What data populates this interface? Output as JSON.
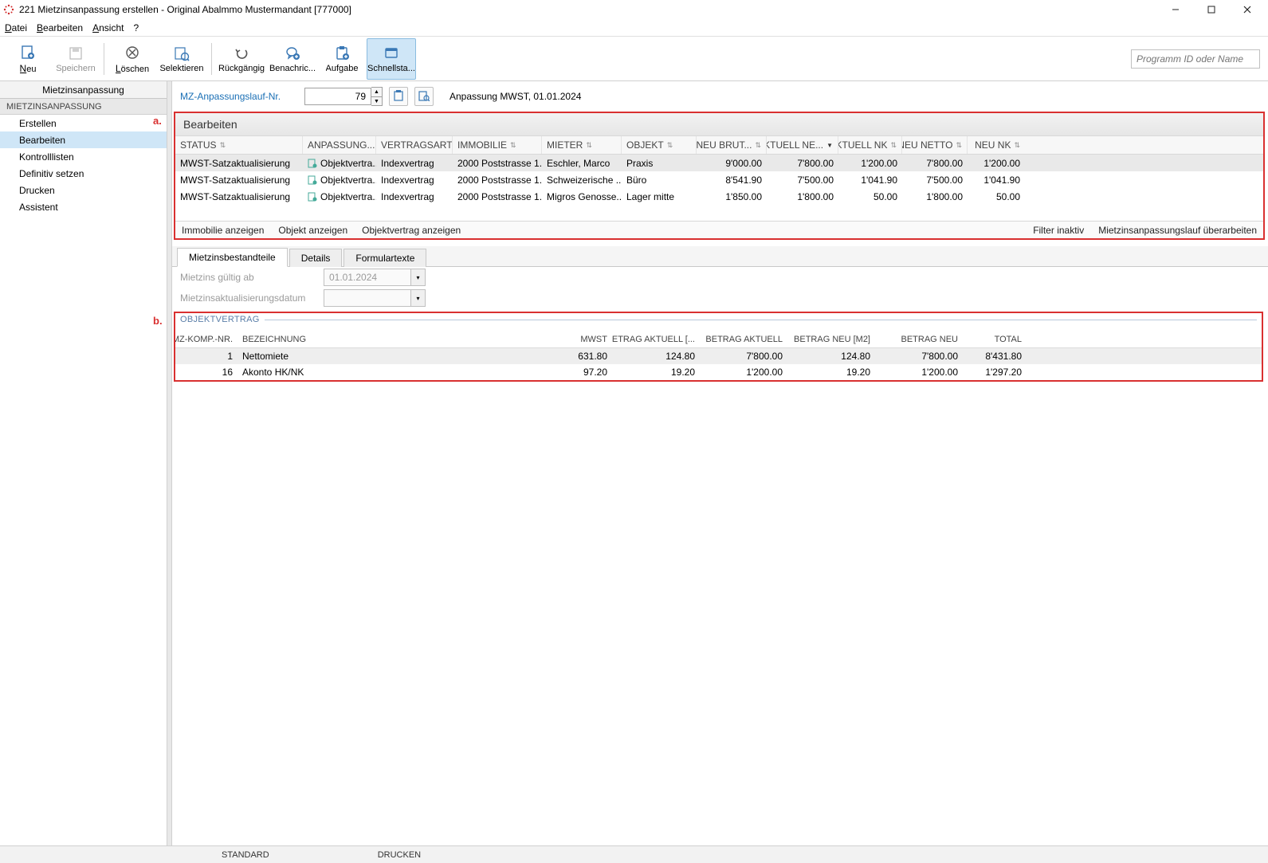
{
  "window": {
    "title": "221 Mietzinsanpassung erstellen - Original Abalmmo Mustermandant [777000]"
  },
  "menu": {
    "datei": "Datei",
    "bearbeiten": "Bearbeiten",
    "ansicht": "Ansicht",
    "help": "?"
  },
  "toolbar": {
    "neu": "Neu",
    "speichern": "Speichern",
    "loeschen": "Löschen",
    "selektieren": "Selektieren",
    "rueckgaengig": "Rückgängig",
    "benachrichtigen": "Benachric...",
    "aufgabe": "Aufgabe",
    "schnellstart": "Schnellsta...",
    "search_placeholder": "Programm ID oder Name"
  },
  "sidebar": {
    "title": "Mietzinsanpassung",
    "group": "MIETZINSANPASSUNG",
    "items": [
      "Erstellen",
      "Bearbeiten",
      "Kontrolllisten",
      "Definitiv setzen",
      "Drucken",
      "Assistent"
    ],
    "selected_index": 1
  },
  "controlrow": {
    "link_label": "MZ-Anpassungslauf-Nr.",
    "value": "79",
    "context": "Anpassung MWST, 01.01.2024"
  },
  "annotations": {
    "a": "a.",
    "b": "b."
  },
  "panelA": {
    "title": "Bearbeiten",
    "columns": [
      "STATUS",
      "ANPASSUNG...",
      "VERTRAGSART",
      "IMMOBILIE",
      "MIETER",
      "OBJEKT",
      "NEU BRUT...",
      "AKTUELL NE...",
      "AKTUELL NK",
      "NEU NETTO",
      "NEU NK"
    ],
    "sorted_desc_col_index": 7,
    "rows": [
      {
        "status": "MWST-Satzaktualisierung",
        "anpassung": "Objektvertra...",
        "vertragsart": "Indexvertrag",
        "immobilie": "2000 Poststrasse 1...",
        "mieter": "Eschler, Marco",
        "objekt": "Praxis",
        "neu_brutto": "9'000.00",
        "aktuell_netto": "7'800.00",
        "aktuell_nk": "1'200.00",
        "neu_netto": "7'800.00",
        "neu_nk": "1'200.00"
      },
      {
        "status": "MWST-Satzaktualisierung",
        "anpassung": "Objektvertra...",
        "vertragsart": "Indexvertrag",
        "immobilie": "2000 Poststrasse 1...",
        "mieter": "Schweizerische ...",
        "objekt": "Büro",
        "neu_brutto": "8'541.90",
        "aktuell_netto": "7'500.00",
        "aktuell_nk": "1'041.90",
        "neu_netto": "7'500.00",
        "neu_nk": "1'041.90"
      },
      {
        "status": "MWST-Satzaktualisierung",
        "anpassung": "Objektvertra...",
        "vertragsart": "Indexvertrag",
        "immobilie": "2000 Poststrasse 1...",
        "mieter": "Migros Genosse...",
        "objekt": "Lager mitte",
        "neu_brutto": "1'850.00",
        "aktuell_netto": "1'800.00",
        "aktuell_nk": "50.00",
        "neu_netto": "1'800.00",
        "neu_nk": "50.00"
      }
    ],
    "footer": {
      "immobilie": "Immobilie anzeigen",
      "objekt": "Objekt anzeigen",
      "objektvertrag": "Objektvertrag anzeigen",
      "filter": "Filter inaktiv",
      "ueberarbeiten": "Mietzinsanpassungslauf überarbeiten"
    }
  },
  "tabs": {
    "items": [
      "Mietzinsbestandteile",
      "Details",
      "Formulartexte"
    ],
    "active_index": 0
  },
  "form": {
    "gueltig_label": "Mietzins gültig ab",
    "gueltig_value": "01.01.2024",
    "aktual_label": "Mietzinsaktualisierungsdatum",
    "aktual_value": ""
  },
  "panelB": {
    "title": "OBJEKTVERTRAG",
    "columns": [
      "MZ-KOMP.-NR.",
      "BEZEICHNUNG",
      "MWST",
      "BETRAG AKTUELL [...",
      "BETRAG AKTUELL",
      "BETRAG NEU [M2]",
      "BETRAG NEU",
      "TOTAL"
    ],
    "rows": [
      {
        "nr": "1",
        "bez": "Nettomiete",
        "mwst": "631.80",
        "bakt_m2": "124.80",
        "bakt": "7'800.00",
        "bneu_m2": "124.80",
        "bneu": "7'800.00",
        "total": "8'431.80"
      },
      {
        "nr": "16",
        "bez": "Akonto HK/NK",
        "mwst": "97.20",
        "bakt_m2": "19.20",
        "bakt": "1'200.00",
        "bneu_m2": "19.20",
        "bneu": "1'200.00",
        "total": "1'297.20"
      }
    ]
  },
  "statusbar": {
    "left": "STANDARD",
    "right": "DRUCKEN"
  }
}
